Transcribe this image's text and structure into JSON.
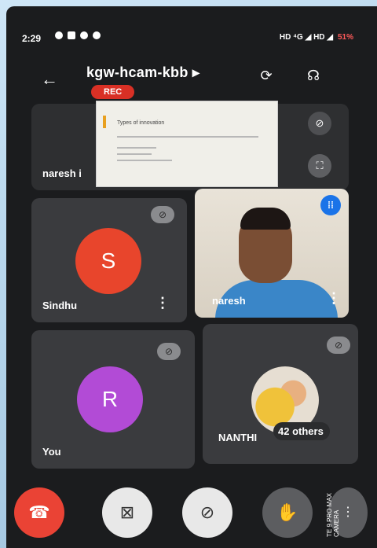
{
  "status_bar": {
    "time": "2:29",
    "network": "HD ⁴G ◢ HD ◢",
    "battery": "51%"
  },
  "header": {
    "meeting_code": "kgw-hcam-kbb ▸",
    "rec_label": "REC"
  },
  "tiles": {
    "presenter": {
      "name": "naresh i",
      "doc_title": "Types of innovation"
    },
    "sindhu": {
      "initial": "S",
      "name": "Sindhu"
    },
    "naresh_video": {
      "name": "naresh"
    },
    "you": {
      "initial": "R",
      "name": "You"
    },
    "others": {
      "name": "NANTHI",
      "others_label": "42 others"
    }
  },
  "colors": {
    "accent_blue": "#1a73e8",
    "end_call_red": "#ea4335",
    "avatar_s": "#e8452c",
    "avatar_r": "#b24bd6"
  },
  "device_label": "TE 9 PRO MAX\nCAMERA"
}
